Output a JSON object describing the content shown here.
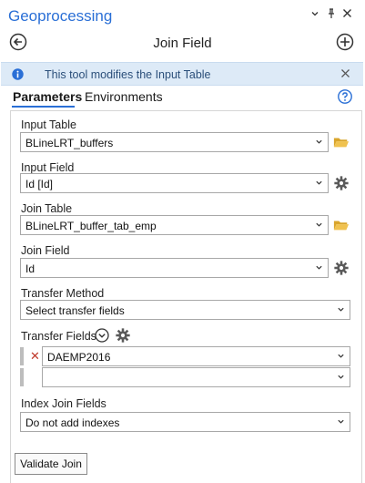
{
  "window": {
    "title": "Geoprocessing",
    "controls": [
      "⌄",
      "ᵖ",
      "✕"
    ]
  },
  "header": {
    "tool_name": "Join Field",
    "back_icon": "back-arrow-circle-icon",
    "add_icon": "add-circle-icon"
  },
  "info_banner": {
    "text": "This tool modifies the Input Table",
    "icon": "info-icon",
    "close": "×"
  },
  "tabs": [
    {
      "label": "Parameters",
      "active": true
    },
    {
      "label": "Environments",
      "active": false
    }
  ],
  "params": {
    "input_table": {
      "label": "Input Table",
      "value": "BLineLRT_buffers"
    },
    "input_field": {
      "label": "Input Field",
      "value": "Id [Id]"
    },
    "join_table": {
      "label": "Join Table",
      "value": "BLineLRT_buffer_tab_emp"
    },
    "join_field": {
      "label": "Join Field",
      "value": "Id"
    },
    "transfer_method": {
      "label": "Transfer Method",
      "value": "Select transfer fields"
    },
    "transfer_fields": {
      "label": "Transfer Fields",
      "rows": [
        {
          "value": "DAEMP2016",
          "removable": true
        },
        {
          "value": "",
          "removable": false
        }
      ]
    },
    "index_join_fields": {
      "label": "Index Join Fields",
      "value": "Do not add indexes"
    }
  },
  "buttons": {
    "validate": "Validate Join"
  },
  "colors": {
    "accent": "#2a6fd6",
    "info_bg": "#ddeaf7",
    "folder": "#e8b43a",
    "remove": "#c0392b"
  }
}
